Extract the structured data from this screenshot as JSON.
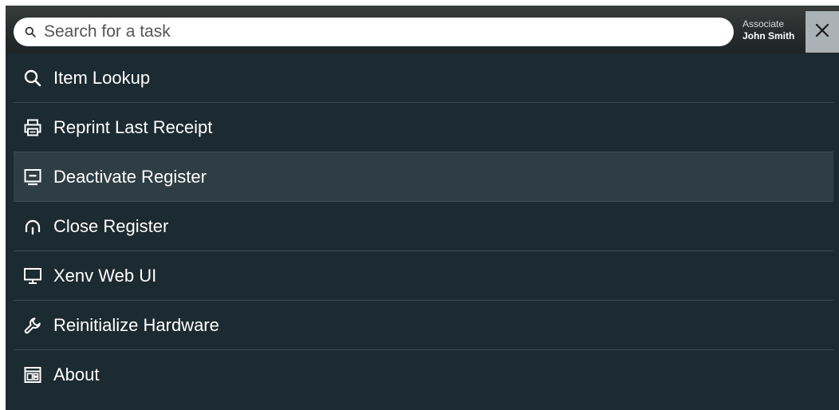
{
  "search": {
    "placeholder": "Search for a task"
  },
  "associate": {
    "role": "Associate",
    "name": "John Smith"
  },
  "close_icon": "close-icon",
  "menu": {
    "items": [
      {
        "label": "Item Lookup",
        "icon": "search-icon"
      },
      {
        "label": "Reprint Last Receipt",
        "icon": "printer-icon"
      },
      {
        "label": "Deactivate Register",
        "icon": "register-icon",
        "highlighted": true
      },
      {
        "label": "Close Register",
        "icon": "headphones-icon"
      },
      {
        "label": "Xenv Web UI",
        "icon": "monitor-icon"
      },
      {
        "label": "Reinitialize Hardware",
        "icon": "wrench-icon"
      },
      {
        "label": "About",
        "icon": "info-panel-icon"
      }
    ]
  },
  "colors": {
    "background": "#1c2a31",
    "highlight": "#2f3e45",
    "divider": "#3d4d55",
    "close_button": "#aab2b5",
    "text": "#ffffff"
  }
}
